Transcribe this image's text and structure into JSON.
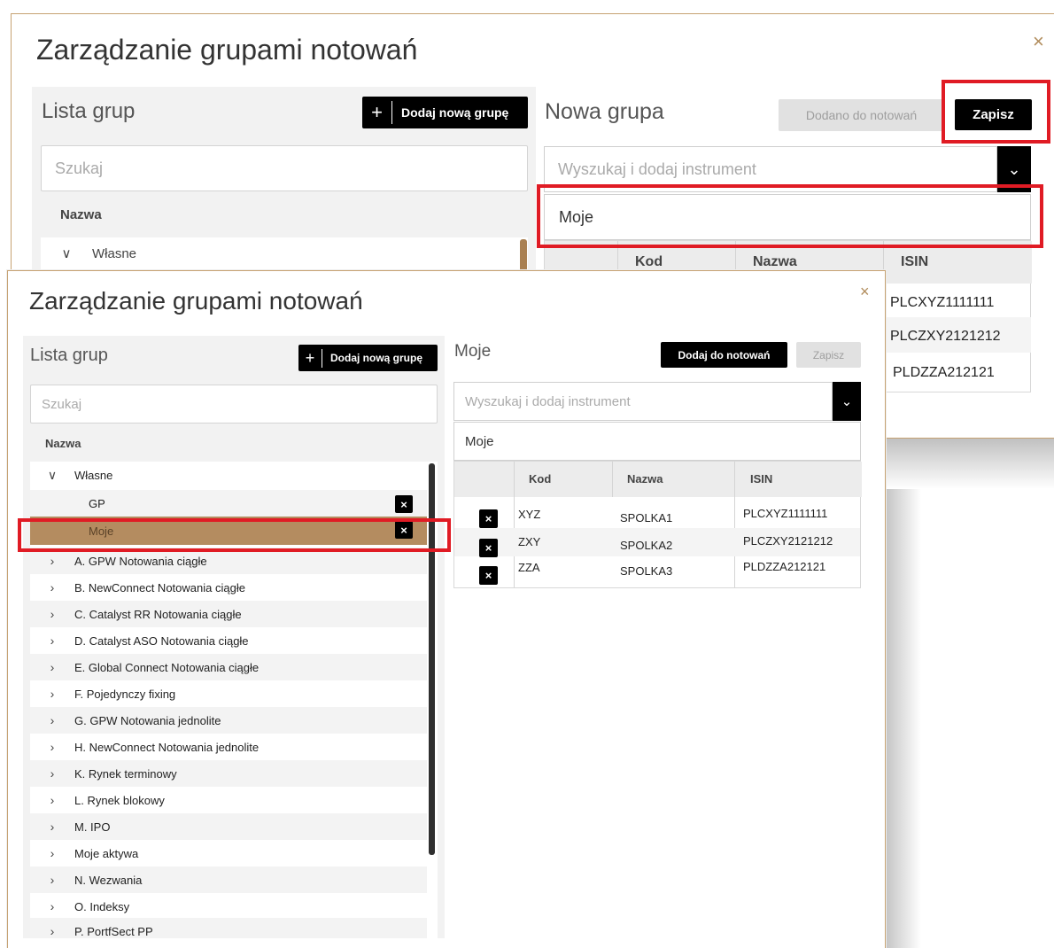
{
  "back_dialog": {
    "title": "Zarządzanie grupami notowań",
    "close": "×",
    "left_panel": {
      "title": "Lista grup",
      "add_button": "Dodaj nową grupę",
      "add_plus": "+",
      "search_placeholder": "Szukaj",
      "column_name": "Nazwa",
      "tree_first": "Własne"
    },
    "right_panel": {
      "title": "Nowa grupa",
      "added_button": "Dodano do notowań",
      "save_button": "Zapisz",
      "instrument_placeholder": "Wyszukaj i dodaj instrument",
      "dropdown_option": "Moje",
      "columns": [
        "Kod",
        "Nazwa",
        "ISIN"
      ],
      "isin_values": [
        "PLCXYZ1111111",
        "PLCZXY2121212",
        "PLDZZA212121"
      ]
    }
  },
  "front_dialog": {
    "title": "Zarządzanie grupami notowań",
    "close": "×",
    "left_panel": {
      "title": "Lista grup",
      "add_button": "Dodaj nową grupę",
      "add_plus": "+",
      "search_placeholder": "Szukaj",
      "column_name": "Nazwa",
      "tree": [
        {
          "label": "Własne",
          "chevron": "∨"
        },
        {
          "label": "GP",
          "chevron": ""
        },
        {
          "label": "Moje",
          "chevron": ""
        },
        {
          "label": "A. GPW Notowania ciągłe",
          "chevron": "›"
        },
        {
          "label": "B. NewConnect Notowania ciągłe",
          "chevron": "›"
        },
        {
          "label": "C. Catalyst RR Notowania ciągłe",
          "chevron": "›"
        },
        {
          "label": "D. Catalyst ASO Notowania ciągłe",
          "chevron": "›"
        },
        {
          "label": "E. Global Connect Notowania ciągłe",
          "chevron": "›"
        },
        {
          "label": "F. Pojedynczy fixing",
          "chevron": "›"
        },
        {
          "label": "G. GPW Notowania jednolite",
          "chevron": "›"
        },
        {
          "label": "H. NewConnect Notowania jednolite",
          "chevron": "›"
        },
        {
          "label": "K. Rynek terminowy",
          "chevron": "›"
        },
        {
          "label": "L. Rynek blokowy",
          "chevron": "›"
        },
        {
          "label": "M. IPO",
          "chevron": "›"
        },
        {
          "label": "Moje aktywa",
          "chevron": "›"
        },
        {
          "label": "N. Wezwania",
          "chevron": "›"
        },
        {
          "label": "O. Indeksy",
          "chevron": "›"
        },
        {
          "label": "P. PortfSect PP",
          "chevron": "›"
        }
      ],
      "delete_icon": "×"
    },
    "right_panel": {
      "title": "Moje",
      "add_to_quotes_button": "Dodaj do notowań",
      "save_button": "Zapisz",
      "instrument_placeholder": "Wyszukaj i dodaj instrument",
      "group_name_value": "Moje",
      "columns": [
        "Kod",
        "Nazwa",
        "ISIN"
      ],
      "rows": [
        {
          "kod": "XYZ",
          "nazwa": "SPOLKA1",
          "isin": "PLCXYZ1111111"
        },
        {
          "kod": "ZXY",
          "nazwa": "SPOLKA2",
          "isin": "PLCZXY2121212"
        },
        {
          "kod": "ZZA",
          "nazwa": "SPOLKA3",
          "isin": "PLDZZA212121"
        }
      ],
      "delete_icon": "×"
    }
  },
  "icons": {
    "chevron_down": "⌄",
    "chevron_down_char": "v"
  },
  "colors": {
    "accent_brown": "#b48c60",
    "highlight_red": "#e01b24",
    "button_black": "#000000"
  }
}
